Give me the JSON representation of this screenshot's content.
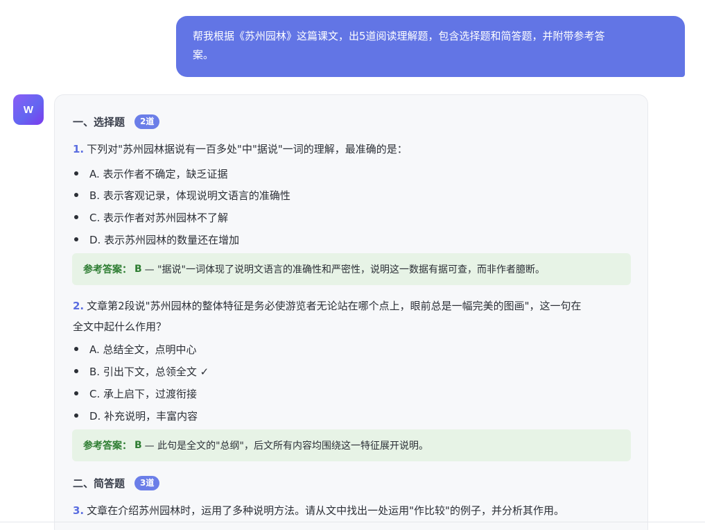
{
  "user_message": {
    "line1": "帮我根据《苏州园林》这篇课文，出5道阅读理解题，包含选择题和简答题，并附带参考答",
    "line2": "案。"
  },
  "assistant": {
    "avatar_letter": "W",
    "section1": {
      "title": "一、选择题",
      "badge": "2道"
    },
    "q1": {
      "num": "1.",
      "text": "下列对\"苏州园林据说有一百多处\"中\"据说\"一词的理解，最准确的是：",
      "options": [
        "A. 表示作者不确定，缺乏证据",
        "B. 表示客观记录，体现说明文语言的准确性",
        "C. 表示作者对苏州园林不了解",
        "D. 表示苏州园林的数量还在增加"
      ],
      "answer_label": "参考答案：",
      "answer_letter": "B",
      "answer_text": "— \"据说\"一词体现了说明文语言的准确性和严密性，说明这一数据有据可查，而非作者臆断。"
    },
    "q2": {
      "num": "2.",
      "text_line1": "文章第2段说\"苏州园林的整体特征是务必使游览者无论站在哪个点上，眼前总是一幅完美的图画\"，这一句在",
      "text_line2": "全文中起什么作用？",
      "options": [
        "A. 总结全文，点明中心",
        "B. 引出下文，总领全文 ✓",
        "C. 承上启下，过渡衔接",
        "D. 补充说明，丰富内容"
      ],
      "answer_label": "参考答案：",
      "answer_letter": "B",
      "answer_text": "— 此句是全文的\"总纲\"，后文所有内容均围绕这一特征展开说明。"
    },
    "section2": {
      "title": "二、简答题",
      "badge": "3道"
    },
    "q3": {
      "num": "3.",
      "text": "文章在介绍苏州园林时，运用了多种说明方法。请从文中找出一处运用\"作比较\"的例子，并分析其作用。"
    }
  }
}
